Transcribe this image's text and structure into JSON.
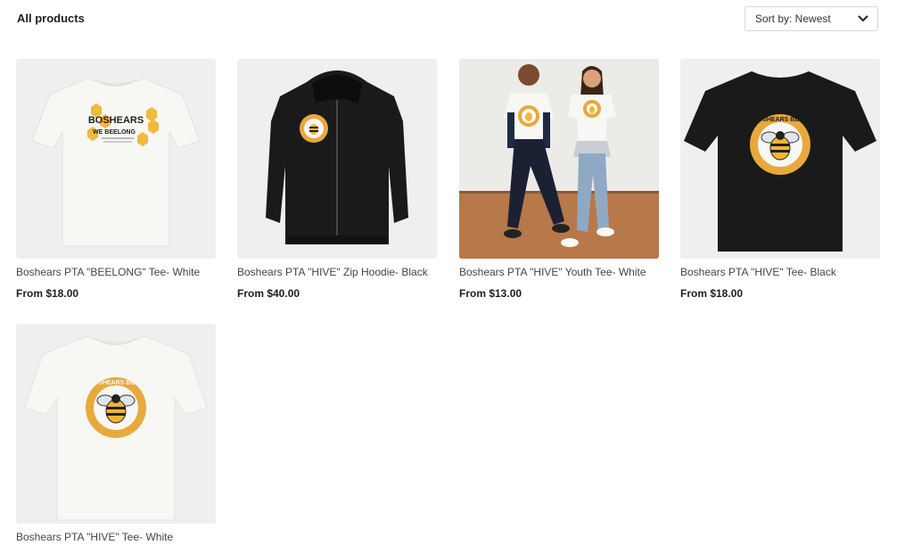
{
  "header": {
    "title": "All products",
    "sort_label": "Sort by: Newest"
  },
  "colors": {
    "accent_yellow": "#f2b632",
    "honey": "#e8a93c",
    "tee_white": "#f7f7f4",
    "tee_black": "#1a1a1a",
    "thumb_bg": "#efefef",
    "floor_brown": "#b7784a"
  },
  "products": [
    {
      "name": "Boshears PTA \"BEELONG\" Tee- White",
      "price": "From $18.00",
      "graphic_text": "BOSHEARS",
      "graphic_subtext": "WE BEELONG"
    },
    {
      "name": "Boshears PTA \"HIVE\" Zip Hoodie- Black",
      "price": "From $40.00"
    },
    {
      "name": "Boshears PTA \"HIVE\" Youth Tee- White",
      "price": "From $13.00"
    },
    {
      "name": "Boshears PTA \"HIVE\" Tee- Black",
      "price": "From $18.00",
      "graphic_text": "BOSHEARS BEES"
    },
    {
      "name": "Boshears PTA \"HIVE\" Tee- White",
      "price": "",
      "graphic_text": "BOSHEARS BEES"
    }
  ]
}
